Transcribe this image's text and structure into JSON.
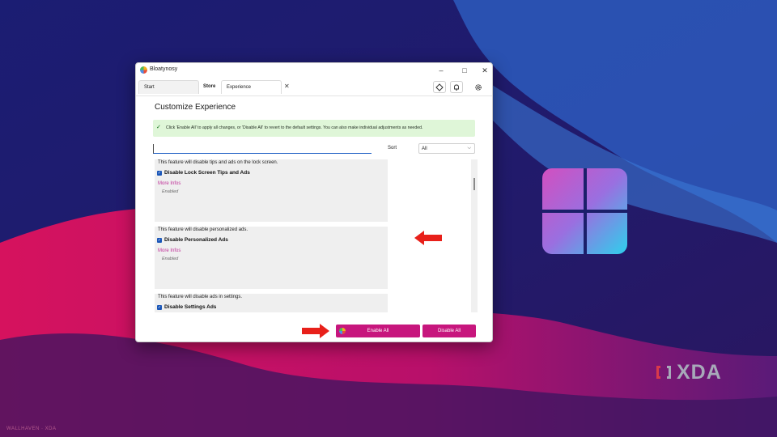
{
  "window": {
    "title": "Bloatynosy",
    "controls": {
      "minimize": "–",
      "maximize": "□",
      "close": "✕"
    }
  },
  "tabs": {
    "start": "Start",
    "store": "Store",
    "experience": "Experience",
    "close_glyph": "✕",
    "icons": [
      "puzzle-icon",
      "bell-icon",
      "gear-icon"
    ]
  },
  "main": {
    "title": "Customize Experience",
    "info": {
      "check_glyph": "✓",
      "message": "Click 'Enable All' to apply all changes, or 'Disable All' to revert to the default settings. You can also make individual adjustments as needed."
    },
    "search": {
      "value": "",
      "placeholder": ""
    },
    "sort": {
      "label": "Sort",
      "selected": "All",
      "chevron": "⌵"
    },
    "items": [
      {
        "description": "This feature will disable tips and ads on the lock screen.",
        "name": "Disable Lock Screen Tips and Ads",
        "checked": true,
        "more": "More Infos",
        "status": "Enabled"
      },
      {
        "description": "This feature will disable personalized ads.",
        "name": "Disable Personalized Ads",
        "checked": true,
        "more": "More Infos",
        "status": "Enabled"
      },
      {
        "description": "This feature will disable ads in settings.",
        "name": "Disable Settings Ads",
        "checked": true
      }
    ],
    "buttons": {
      "enable_all": "Enable All",
      "disable_all": "Disable All"
    }
  },
  "branding": {
    "xda": "XDA",
    "credit": "WALLHAVEN · XDA"
  },
  "colors": {
    "accent": "#c7167d",
    "info_bg": "#dff6d8",
    "arrow": "#e8201a",
    "link": "#c0339a",
    "checkbox": "#1a56b8"
  }
}
